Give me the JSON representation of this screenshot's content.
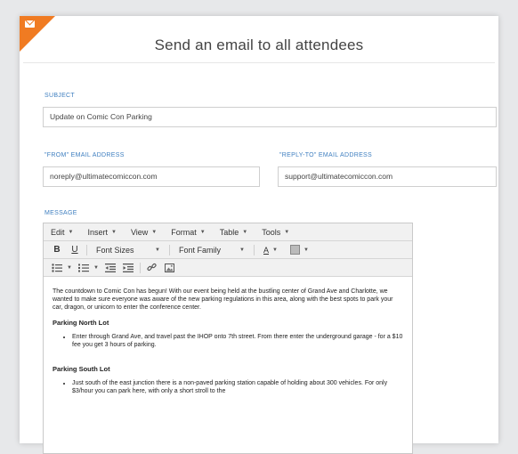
{
  "title": "Send an email to all attendees",
  "subject": {
    "label": "SUBJECT",
    "value": "Update on Comic Con Parking"
  },
  "from": {
    "label": "\"FROM\" EMAIL ADDRESS",
    "value": "noreply@ultimatecomiccon.com"
  },
  "reply_to": {
    "label": "\"REPLY-TO\" EMAIL ADDRESS",
    "value": "support@ultimatecomiccon.com"
  },
  "message": {
    "label": "MESSAGE",
    "menu": [
      "Edit",
      "Insert",
      "View",
      "Format",
      "Table",
      "Tools"
    ],
    "toolbar": {
      "bold": "B",
      "underline": "U",
      "font_sizes": "Font Sizes",
      "font_family": "Font Family",
      "text_color": "A"
    },
    "body": {
      "intro": "The countdown to Comic Con has begun! With our event being held at the bustling center of Grand Ave and Charlotte, we wanted to make sure everyone was aware of the new parking regulations in this area, along with the best spots to park your car, dragon, or unicorn to enter the conference center.",
      "north_heading": "Parking North Lot",
      "north_item": "Enter through Grand Ave, and travel past the IHOP onto 7th street. From there enter the underground garage - for a $10 fee you get 3 hours of parking.",
      "south_heading": "Parking South Lot",
      "south_item": "Just south of the east junction there is a non-paved parking station capable of holding about 300 vehicles. For only $3/hour you can park here, with only a short stroll to the"
    }
  },
  "colors": {
    "accent": "#f07b22",
    "label_blue": "#3f7fc0"
  }
}
